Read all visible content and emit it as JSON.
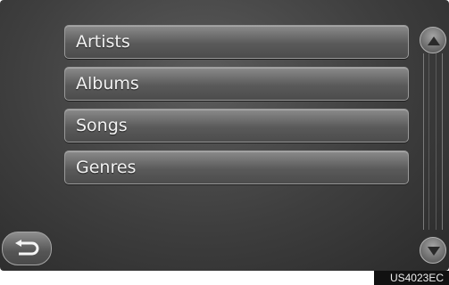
{
  "menu": {
    "items": [
      {
        "label": "Artists"
      },
      {
        "label": "Albums"
      },
      {
        "label": "Songs"
      },
      {
        "label": "Genres"
      }
    ]
  },
  "icons": {
    "back": "back-arrow-icon",
    "scroll_up": "triangle-up-icon",
    "scroll_down": "triangle-down-icon"
  },
  "figure_code": "US4023EC",
  "colors": {
    "screen_bg": "#3e3e3e",
    "button_face": "#5a5a5a",
    "text": "#f2f2f2"
  }
}
